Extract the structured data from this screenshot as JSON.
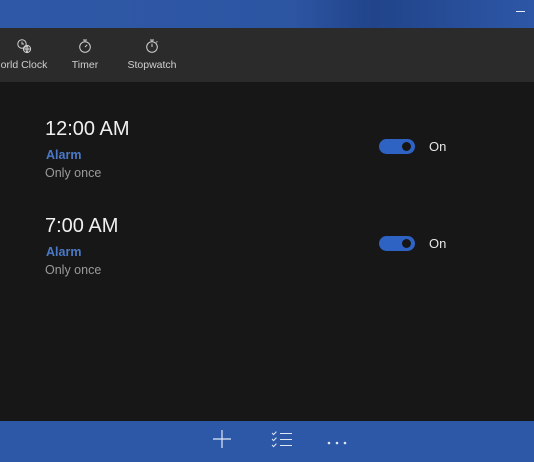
{
  "window": {
    "minimize_icon": "minimize-icon"
  },
  "nav": {
    "items": [
      {
        "label": "orld Clock",
        "icon": "world-clock-icon"
      },
      {
        "label": "Timer",
        "icon": "timer-icon"
      },
      {
        "label": "Stopwatch",
        "icon": "stopwatch-icon"
      }
    ]
  },
  "alarms": [
    {
      "time": "12:00 AM",
      "name": "Alarm",
      "repeat": "Only once",
      "enabled": true,
      "state_label": "On"
    },
    {
      "time": "7:00 AM",
      "name": "Alarm",
      "repeat": "Only once",
      "enabled": true,
      "state_label": "On"
    }
  ],
  "commandbar": {
    "buttons": [
      {
        "icon": "add-icon"
      },
      {
        "icon": "select-list-icon"
      },
      {
        "icon": "more-icon"
      }
    ]
  },
  "colors": {
    "accent": "#2d58a7",
    "toggle_on": "#2e63c4",
    "alarm_name": "#4b79c8",
    "background": "#171717",
    "navbar": "#2b2b2b"
  }
}
